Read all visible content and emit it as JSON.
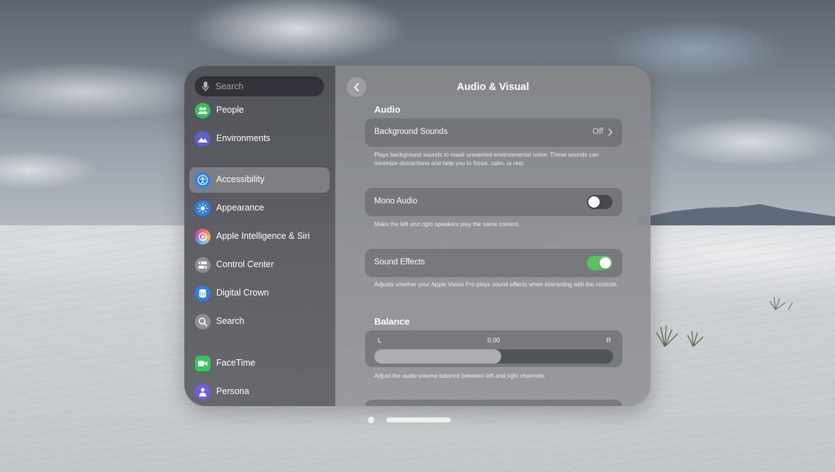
{
  "sidebar": {
    "search": {
      "placeholder": "Search"
    },
    "items": [
      {
        "label": "People",
        "icon": "people-icon",
        "color": "#33c15a"
      },
      {
        "label": "Environments",
        "icon": "mountain-icon",
        "color": "#5a5fd6"
      },
      {
        "label": "Accessibility",
        "icon": "accessibility-icon",
        "color": "#1f86ff",
        "selected": true
      },
      {
        "label": "Appearance",
        "icon": "sun-icon",
        "color": "#2a7ff0"
      },
      {
        "label": "Apple Intelligence & Siri",
        "icon": "siri-icon",
        "color": "#ff7a59"
      },
      {
        "label": "Control Center",
        "icon": "toggles-icon",
        "color": "#8e8e93"
      },
      {
        "label": "Digital Crown",
        "icon": "crown-icon",
        "color": "#2a7ff0"
      },
      {
        "label": "Search",
        "icon": "magnifier-icon",
        "color": "#8e8e93"
      },
      {
        "label": "FaceTime",
        "icon": "video-camera-icon",
        "color": "#34c759"
      },
      {
        "label": "Persona",
        "icon": "persona-icon",
        "color": "#6e5ce6"
      }
    ]
  },
  "main": {
    "title": "Audio & Visual",
    "audio_section": "Audio",
    "background_sounds": {
      "label": "Background Sounds",
      "value": "Off",
      "caption": "Plays background sounds to mask unwanted environmental noise. These sounds can minimize distractions and help you to focus, calm, or rest."
    },
    "mono_audio": {
      "label": "Mono Audio",
      "enabled": false,
      "caption": "Make the left and right speakers play the same content."
    },
    "sound_effects": {
      "label": "Sound Effects",
      "enabled": true,
      "caption": "Adjusts whether your Apple Vision Pro plays sound effects when interacting with the controls."
    },
    "balance_section": "Balance",
    "balance": {
      "left_label": "L",
      "right_label": "R",
      "value": "0.00",
      "fill_fraction": 0.53,
      "caption": "Adjust the audio volume balance between left and right channels."
    }
  },
  "colors": {
    "toggle_on": "#5ac35f",
    "selected_item": "rgba(255,255,255,0.22)"
  }
}
